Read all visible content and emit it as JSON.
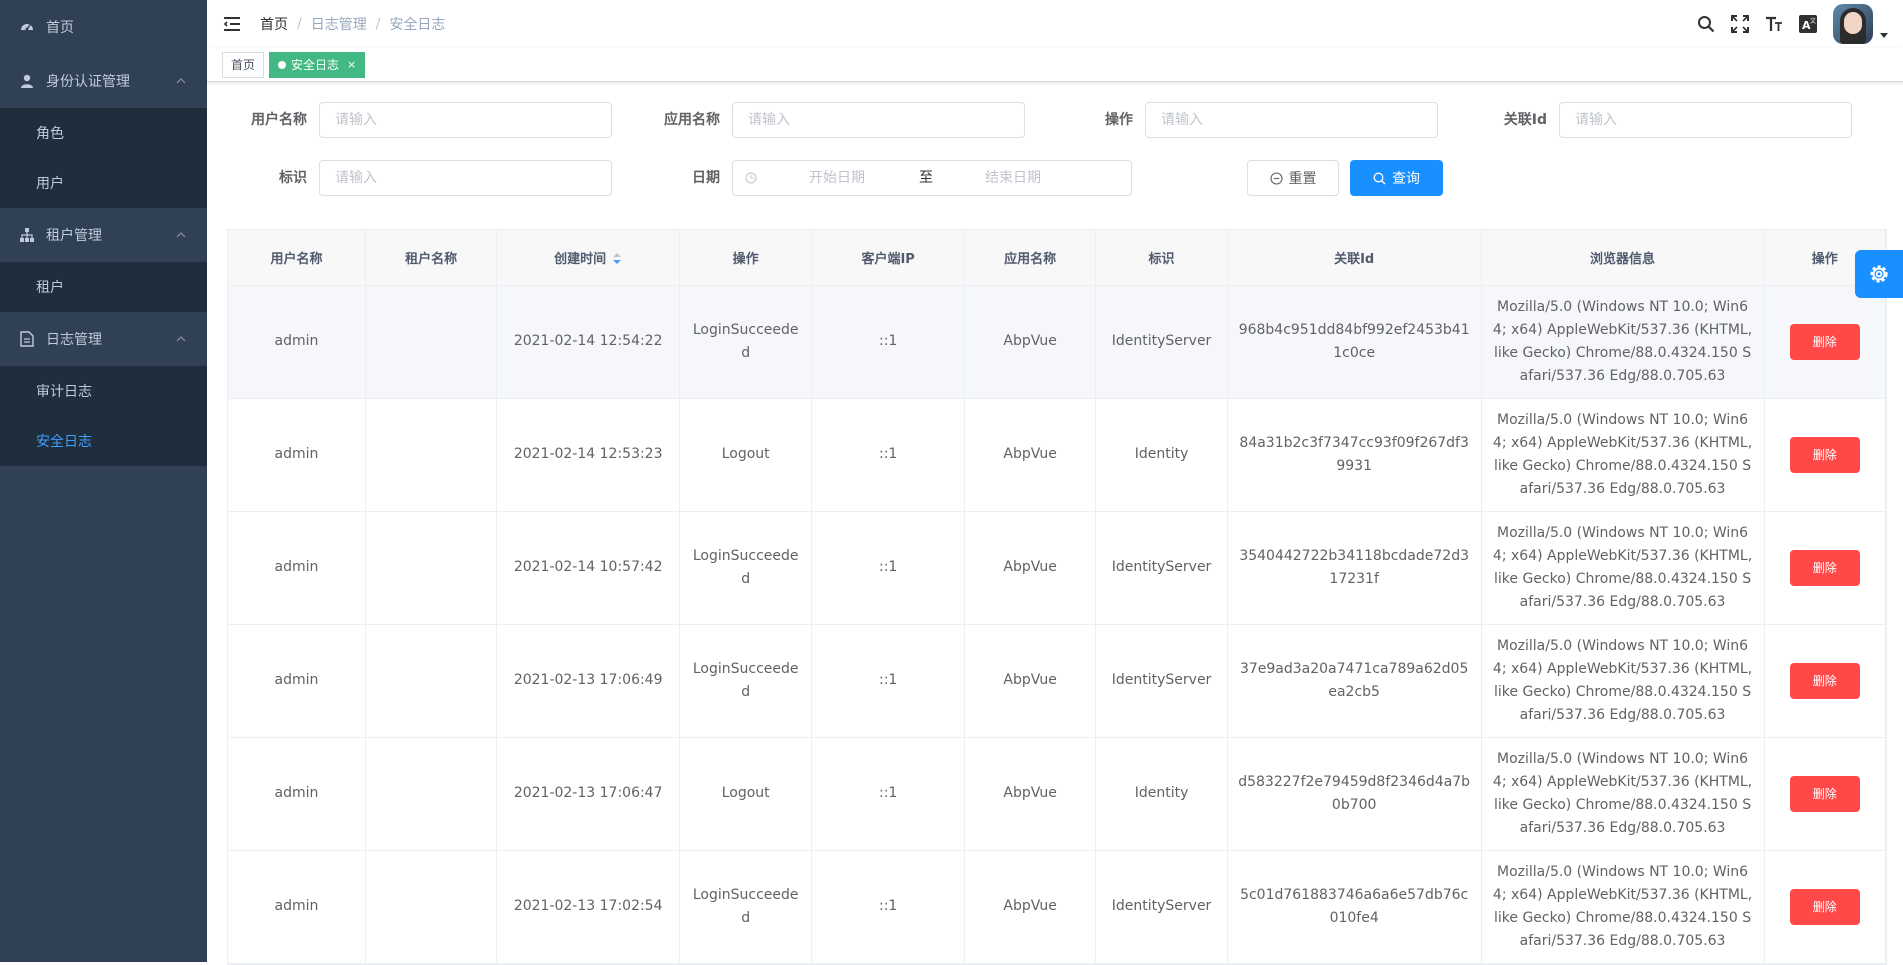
{
  "sidebar": {
    "items": [
      {
        "label": "首页",
        "icon": "dashboard-icon"
      },
      {
        "label": "身份认证管理",
        "icon": "user-icon",
        "children": [
          {
            "label": "角色"
          },
          {
            "label": "用户"
          }
        ]
      },
      {
        "label": "租户管理",
        "icon": "tree-icon",
        "children": [
          {
            "label": "租户"
          }
        ]
      },
      {
        "label": "日志管理",
        "icon": "document-icon",
        "children": [
          {
            "label": "审计日志"
          },
          {
            "label": "安全日志",
            "active": true
          }
        ]
      }
    ]
  },
  "navbar": {
    "breadcrumb": [
      "首页",
      "日志管理",
      "安全日志"
    ],
    "separator": "/"
  },
  "tags": [
    {
      "label": "首页",
      "active": false
    },
    {
      "label": "安全日志",
      "active": true,
      "close": "×"
    }
  ],
  "filters": {
    "username_label": "用户名称",
    "appname_label": "应用名称",
    "action_label": "操作",
    "correlation_label": "关联Id",
    "identity_label": "标识",
    "date_label": "日期",
    "placeholder": "请输入",
    "start_date": "开始日期",
    "range_sep": "至",
    "end_date": "结束日期",
    "reset_label": "重置",
    "search_label": "查询"
  },
  "table": {
    "headers": [
      "用户名称",
      "租户名称",
      "创建时间",
      "操作",
      "客户端IP",
      "应用名称",
      "标识",
      "关联Id",
      "浏览器信息",
      "操作"
    ],
    "rows": [
      {
        "user": "admin",
        "tenant": "",
        "time": "2021-02-14 12:54:22",
        "action": "LoginSucceeded",
        "ip": "::1",
        "app": "AbpVue",
        "identity": "IdentityServer",
        "corr": "968b4c951dd84bf992ef2453b411c0ce",
        "browser": "Mozilla/5.0 (Windows NT 10.0; Win64; x64) AppleWebKit/537.36 (KHTML, like Gecko) Chrome/88.0.4324.150 Safari/537.36 Edg/88.0.705.63",
        "del": "删除"
      },
      {
        "user": "admin",
        "tenant": "",
        "time": "2021-02-14 12:53:23",
        "action": "Logout",
        "ip": "::1",
        "app": "AbpVue",
        "identity": "Identity",
        "corr": "84a31b2c3f7347cc93f09f267df39931",
        "browser": "Mozilla/5.0 (Windows NT 10.0; Win64; x64) AppleWebKit/537.36 (KHTML, like Gecko) Chrome/88.0.4324.150 Safari/537.36 Edg/88.0.705.63",
        "del": "删除"
      },
      {
        "user": "admin",
        "tenant": "",
        "time": "2021-02-14 10:57:42",
        "action": "LoginSucceeded",
        "ip": "::1",
        "app": "AbpVue",
        "identity": "IdentityServer",
        "corr": "3540442722b34118bcdade72d317231f",
        "browser": "Mozilla/5.0 (Windows NT 10.0; Win64; x64) AppleWebKit/537.36 (KHTML, like Gecko) Chrome/88.0.4324.150 Safari/537.36 Edg/88.0.705.63",
        "del": "删除"
      },
      {
        "user": "admin",
        "tenant": "",
        "time": "2021-02-13 17:06:49",
        "action": "LoginSucceeded",
        "ip": "::1",
        "app": "AbpVue",
        "identity": "IdentityServer",
        "corr": "37e9ad3a20a7471ca789a62d05ea2cb5",
        "browser": "Mozilla/5.0 (Windows NT 10.0; Win64; x64) AppleWebKit/537.36 (KHTML, like Gecko) Chrome/88.0.4324.150 Safari/537.36 Edg/88.0.705.63",
        "del": "删除"
      },
      {
        "user": "admin",
        "tenant": "",
        "time": "2021-02-13 17:06:47",
        "action": "Logout",
        "ip": "::1",
        "app": "AbpVue",
        "identity": "Identity",
        "corr": "d583227f2e79459d8f2346d4a7b0b700",
        "browser": "Mozilla/5.0 (Windows NT 10.0; Win64; x64) AppleWebKit/537.36 (KHTML, like Gecko) Chrome/88.0.4324.150 Safari/537.36 Edg/88.0.705.63",
        "del": "删除"
      },
      {
        "user": "admin",
        "tenant": "",
        "time": "2021-02-13 17:02:54",
        "action": "LoginSucceeded",
        "ip": "::1",
        "app": "AbpVue",
        "identity": "IdentityServer",
        "corr": "5c01d761883746a6a6e57db76c010fe4",
        "browser": "Mozilla/5.0 (Windows NT 10.0; Win64; x64) AppleWebKit/537.36 (KHTML, like Gecko) Chrome/88.0.4324.150 Safari/537.36 Edg/88.0.705.63",
        "del": "删除"
      }
    ]
  },
  "colors": {
    "sidebar_bg": "#304156",
    "submenu_bg": "#1f2d3d",
    "accent": "#1890ff",
    "tag_active": "#42b983",
    "danger": "#ff4949"
  }
}
